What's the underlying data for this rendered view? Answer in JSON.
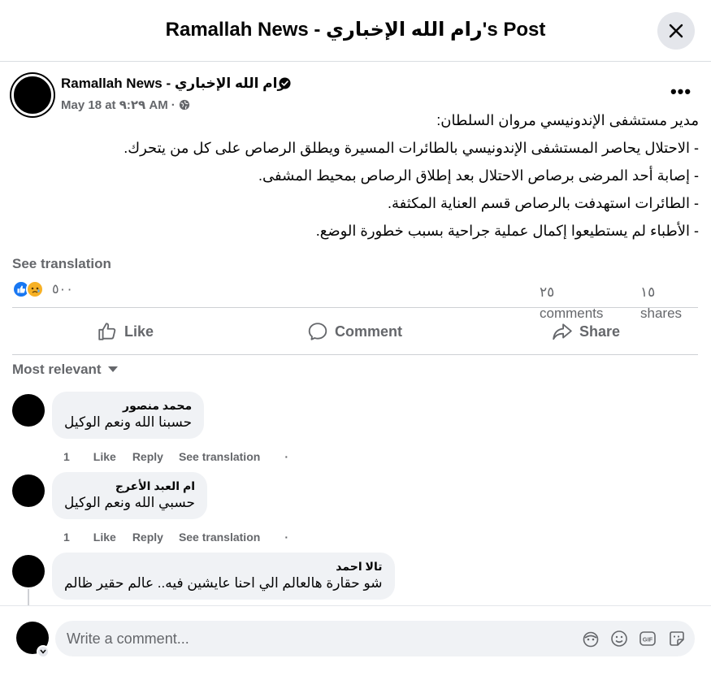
{
  "header": {
    "title": "Ramallah News - رام الله الإخباري's Post"
  },
  "post": {
    "page_name": "Ramallah News - رام الله الإخباري",
    "date": "May 18 at ٩:٢٩ AM",
    "separator": "·",
    "more": "•••",
    "lines": [
      "مدير مستشفى الإندونيسي مروان السلطان:",
      "- الاحتلال يحاصر المستشفى الإندونيسي بالطائرات المسيرة ويطلق الرصاص على كل من يتحرك.",
      "- إصابة أحد المرضى برصاص الاحتلال بعد إطلاق الرصاص بمحيط المشفى.",
      "- الطائرات استهدفت بالرصاص قسم العناية المكثفة.",
      "- الأطباء لم يستطيعوا إكمال عملية جراحية بسبب خطورة الوضع."
    ],
    "see_translation": "See translation",
    "reaction_count": "٥٠٠",
    "comments_count": "٢٥ comments",
    "shares_count": "١٥ shares"
  },
  "actions": {
    "like": "Like",
    "comment": "Comment",
    "share": "Share"
  },
  "sort": {
    "label": "Most relevant"
  },
  "comments": [
    {
      "author": "محمد منصور",
      "text": "حسبنا الله ونعم الوكيل",
      "count": "1",
      "like": "Like",
      "reply": "Reply",
      "translate": "See translation",
      "dot": "·"
    },
    {
      "author": "ام العبد الأعرج",
      "text": "حسبي الله ونعم الوكيل",
      "count": "1",
      "like": "Like",
      "reply": "Reply",
      "translate": "See translation",
      "dot": "·"
    },
    {
      "author": "تالا احمد",
      "text": "شو حقارة هالعالم الي احنا عايشين فيه.. عالم حقير ظالم"
    }
  ],
  "composer": {
    "placeholder": "Write a comment..."
  },
  "icons": {
    "close": "close-icon",
    "verified": "verified-badge-icon",
    "globe": "globe-icon",
    "like_reaction": "like-reaction-icon",
    "sad_reaction": "sad-reaction-icon",
    "like": "thumbs-up-icon",
    "comment": "comment-bubble-icon",
    "share": "share-arrow-icon",
    "sort": "caret-down-icon",
    "avatar_sticker": "avatar-sticker-icon",
    "emoji": "emoji-icon",
    "gif": "gif-icon",
    "sticker": "sticker-icon"
  },
  "colors": {
    "accent": "#1877f2",
    "text_secondary": "#65676b",
    "bubble": "#f0f2f5",
    "sad": "#f7b125"
  }
}
